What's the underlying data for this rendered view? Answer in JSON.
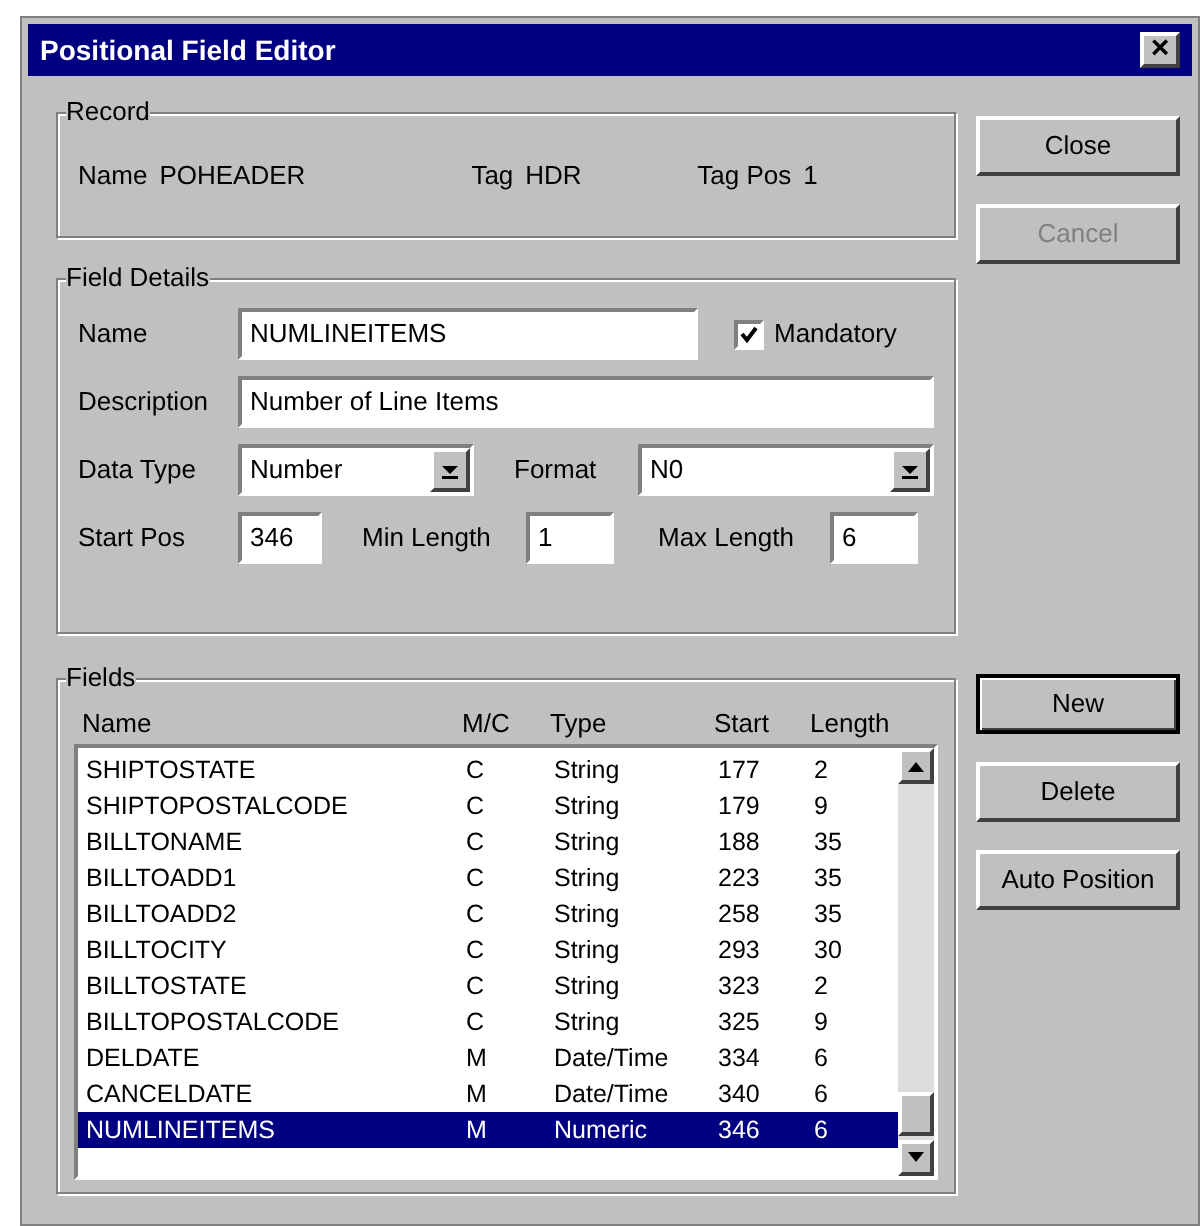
{
  "window": {
    "title": "Positional Field Editor",
    "close_glyph": "×"
  },
  "record": {
    "legend": "Record",
    "name_label": "Name",
    "name": "POHEADER",
    "tag_label": "Tag",
    "tag": "HDR",
    "tagpos_label": "Tag Pos",
    "tagpos": "1"
  },
  "buttons_top": [
    {
      "label": "Close",
      "disabled": false,
      "default": false
    },
    {
      "label": "Cancel",
      "disabled": true,
      "default": false
    }
  ],
  "details": {
    "legend": "Field Details",
    "name_label": "Name",
    "name": "NUMLINEITEMS",
    "mandatory_label": "Mandatory",
    "mandatory": true,
    "description_label": "Description",
    "description": "Number of Line Items",
    "datatype_label": "Data Type",
    "datatype": "Number",
    "format_label": "Format",
    "format": "N0",
    "startpos_label": "Start Pos",
    "startpos": "346",
    "minlength_label": "Min Length",
    "minlength": "1",
    "maxlength_label": "Max Length",
    "maxlength": "6"
  },
  "fields": {
    "legend": "Fields",
    "columns": [
      "Name",
      "M/C",
      "Type",
      "Start",
      "Length"
    ],
    "rows": [
      {
        "cells": [
          "SHIPTOSTATE",
          "C",
          "String",
          "177",
          "2"
        ],
        "selected": false
      },
      {
        "cells": [
          "SHIPTOPOSTALCODE",
          "C",
          "String",
          "179",
          "9"
        ],
        "selected": false
      },
      {
        "cells": [
          "BILLTONAME",
          "C",
          "String",
          "188",
          "35"
        ],
        "selected": false
      },
      {
        "cells": [
          "BILLTOADD1",
          "C",
          "String",
          "223",
          "35"
        ],
        "selected": false
      },
      {
        "cells": [
          "BILLTOADD2",
          "C",
          "String",
          "258",
          "35"
        ],
        "selected": false
      },
      {
        "cells": [
          "BILLTOCITY",
          "C",
          "String",
          "293",
          "30"
        ],
        "selected": false
      },
      {
        "cells": [
          "BILLTOSTATE",
          "C",
          "String",
          "323",
          "2"
        ],
        "selected": false
      },
      {
        "cells": [
          "BILLTOPOSTALCODE",
          "C",
          "String",
          "325",
          "9"
        ],
        "selected": false
      },
      {
        "cells": [
          "DELDATE",
          "M",
          "Date/Time",
          "334",
          "6"
        ],
        "selected": false
      },
      {
        "cells": [
          "CANCELDATE",
          "M",
          "Date/Time",
          "340",
          "6"
        ],
        "selected": false
      },
      {
        "cells": [
          "NUMLINEITEMS",
          "M",
          "Numeric",
          "346",
          "6"
        ],
        "selected": true
      }
    ]
  },
  "buttons_side": [
    {
      "label": "New",
      "disabled": false,
      "default": true
    },
    {
      "label": "Delete",
      "disabled": false,
      "default": false
    },
    {
      "label": "Auto Position",
      "disabled": false,
      "default": false
    }
  ]
}
